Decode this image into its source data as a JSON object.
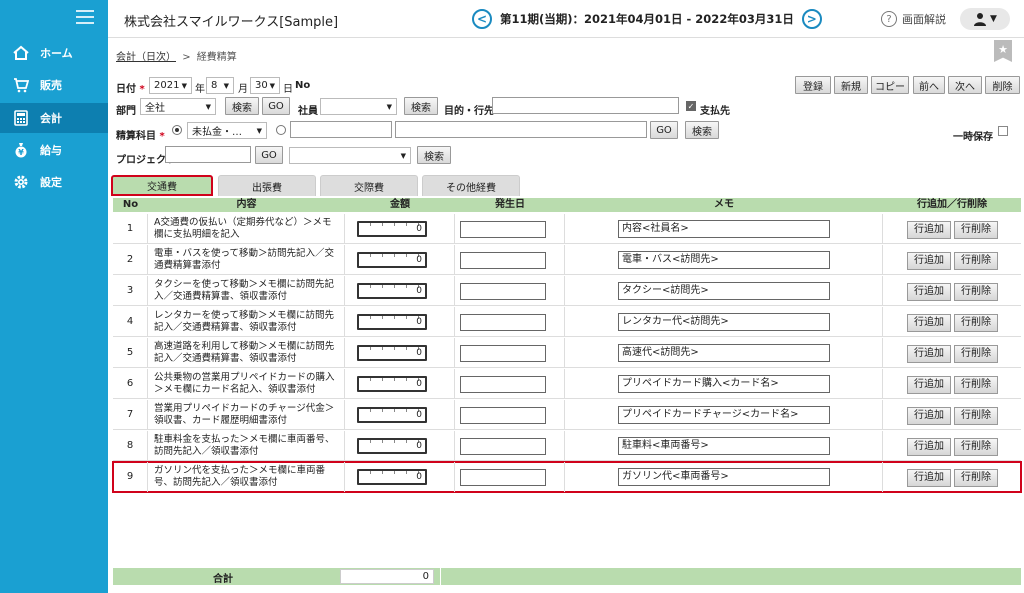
{
  "sidebar": {
    "items": [
      {
        "label": "ホーム",
        "icon": "home-icon"
      },
      {
        "label": "販売",
        "icon": "cart-icon"
      },
      {
        "label": "会計",
        "icon": "calculator-icon"
      },
      {
        "label": "給与",
        "icon": "money-bag-icon"
      },
      {
        "label": "設定",
        "icon": "gear-icon"
      }
    ]
  },
  "header": {
    "company": "株式会社スマイルワークス[Sample]",
    "period": "第11期(当期)：2021年04月01日 - 2022年03月31日",
    "prev": "<",
    "next": ">",
    "help": "画面解説",
    "help_mark": "?"
  },
  "breadcrumb": {
    "link": "会計（日次）",
    "sep": ">",
    "current": "経費精算"
  },
  "form": {
    "date_label": "日付",
    "required_mark": "*",
    "year": "2021",
    "year_unit": "年",
    "month": "8",
    "month_unit": "月",
    "day": "30",
    "day_unit": "日",
    "no_label": "No",
    "dept_label": "部門",
    "dept_value": "全社",
    "search_label": "検索",
    "go_label": "GO",
    "employee_label": "社員",
    "purpose_label": "目的・行先",
    "payee_label": "支払先",
    "account_label": "精算科目",
    "account_value": "未払金・…",
    "project_label": "プロジェクト",
    "temp_save_label": "一時保存"
  },
  "toolbar": {
    "register": "登録",
    "new": "新規",
    "copy": "コピー",
    "prev": "前へ",
    "next": "次へ",
    "delete": "削除"
  },
  "tabs": [
    "交通費",
    "出張費",
    "交際費",
    "その他経費"
  ],
  "table": {
    "headers": [
      "No",
      "内容",
      "金額",
      "発生日",
      "メモ",
      "行追加／行削除"
    ],
    "add_label": "行追加",
    "remove_label": "行削除",
    "rows": [
      {
        "no": "1",
        "desc": "A交通費の仮払い（定期券代など）＞メモ欄に支払明細を記入",
        "amount": "0",
        "memo": "内容<社員名>"
      },
      {
        "no": "2",
        "desc": "電車・バスを使って移動＞訪問先記入／交通費精算書添付",
        "amount": "0",
        "memo": "電車・バス<訪問先>"
      },
      {
        "no": "3",
        "desc": "タクシーを使って移動＞メモ欄に訪問先記入／交通費精算書、領収書添付",
        "amount": "0",
        "memo": "タクシー<訪問先>"
      },
      {
        "no": "4",
        "desc": "レンタカーを使って移動＞メモ欄に訪問先記入／交通費精算書、領収書添付",
        "amount": "0",
        "memo": "レンタカー代<訪問先>"
      },
      {
        "no": "5",
        "desc": "高速道路を利用して移動＞メモ欄に訪問先記入／交通費精算書、領収書添付",
        "amount": "0",
        "memo": "高速代<訪問先>"
      },
      {
        "no": "6",
        "desc": "公共乗物の営業用プリペイドカードの購入＞メモ欄にカード名記入、領収書添付",
        "amount": "0",
        "memo": "プリペイドカード購入<カード名>"
      },
      {
        "no": "7",
        "desc": "営業用プリペイドカードのチャージ代金＞領収書、カード履歴明細書添付",
        "amount": "0",
        "memo": "プリペイドカードチャージ<カード名>"
      },
      {
        "no": "8",
        "desc": "駐車料金を支払った＞メモ欄に車両番号、訪問先記入／領収書添付",
        "amount": "0",
        "memo": "駐車料<車両番号>"
      },
      {
        "no": "9",
        "desc": "ガソリン代を支払った＞メモ欄に車両番号、訪問先記入／領収書添付",
        "amount": "0",
        "memo": "ガソリン代<車両番号>"
      }
    ]
  },
  "footer": {
    "total_label": "合計",
    "total_value": "0"
  },
  "colors": {
    "sidebar": "#1aa0d2",
    "active_nav": "#0d7fb0",
    "table_header": "#b9dcae",
    "highlight": "#d0021b"
  }
}
